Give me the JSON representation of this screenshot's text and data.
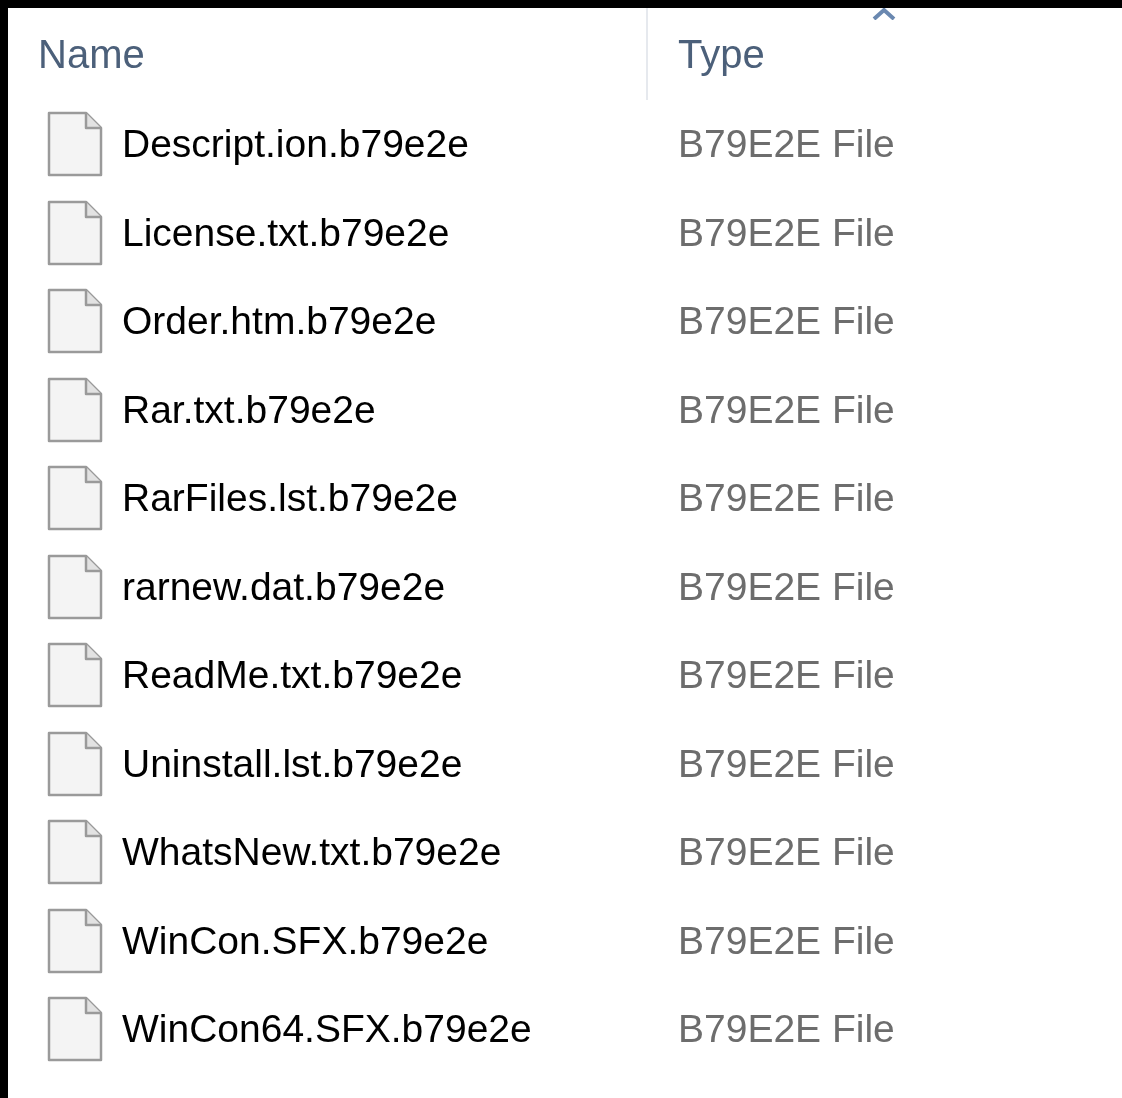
{
  "columns": [
    {
      "label": "Name"
    },
    {
      "label": "Type",
      "sorted": true
    }
  ],
  "files": [
    {
      "name": "Descript.ion.b79e2e",
      "type": "B79E2E File"
    },
    {
      "name": "License.txt.b79e2e",
      "type": "B79E2E File"
    },
    {
      "name": "Order.htm.b79e2e",
      "type": "B79E2E File"
    },
    {
      "name": "Rar.txt.b79e2e",
      "type": "B79E2E File"
    },
    {
      "name": "RarFiles.lst.b79e2e",
      "type": "B79E2E File"
    },
    {
      "name": "rarnew.dat.b79e2e",
      "type": "B79E2E File"
    },
    {
      "name": "ReadMe.txt.b79e2e",
      "type": "B79E2E File"
    },
    {
      "name": "Uninstall.lst.b79e2e",
      "type": "B79E2E File"
    },
    {
      "name": "WhatsNew.txt.b79e2e",
      "type": "B79E2E File"
    },
    {
      "name": "WinCon.SFX.b79e2e",
      "type": "B79E2E File"
    },
    {
      "name": "WinCon64.SFX.b79e2e",
      "type": "B79E2E File"
    }
  ]
}
